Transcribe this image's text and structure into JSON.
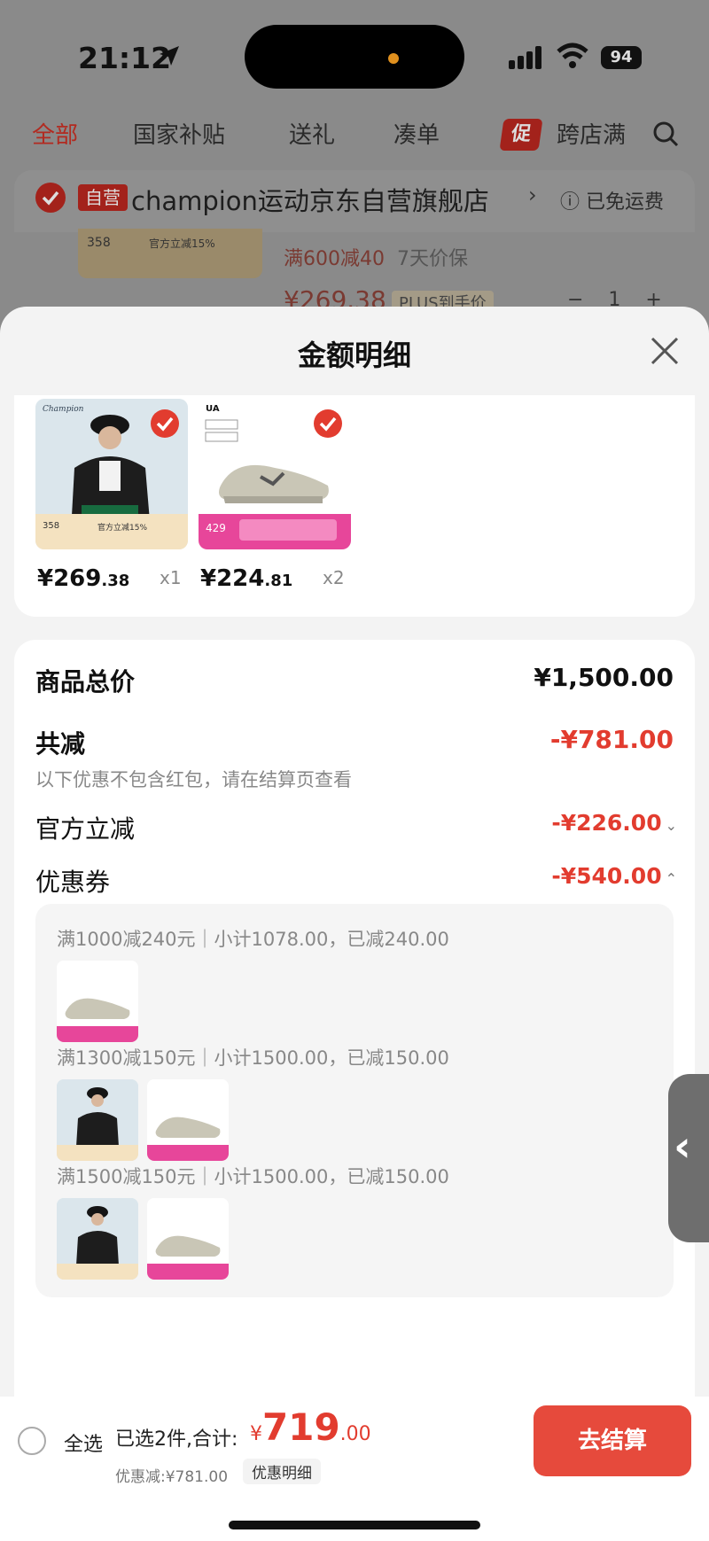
{
  "status": {
    "time": "21:12",
    "battery": "94"
  },
  "tabs": [
    "全部",
    "国家补贴",
    "送礼",
    "凑单",
    "跨店满"
  ],
  "tab_promo_badge": "促",
  "store": {
    "tag": "自营",
    "name": "champion运动京东自营旗舰店",
    "free_shipping": "已免运费",
    "promo": "满600减40",
    "price_protect": "7天价保",
    "price": "¥269.38",
    "plus_label": "PLUS到手价",
    "qty": "1",
    "minus": "−",
    "plus": "+",
    "thumb_price": "358",
    "thumb_tag": "官方立减15%"
  },
  "sheet": {
    "title": "金额明细",
    "products": [
      {
        "price_int": "¥269",
        "price_dec": ".38",
        "qty": "x1",
        "thumb_price": "358",
        "thumb_tag": "官方立减15%",
        "thumb_brand": "Champion"
      },
      {
        "price_int": "¥224",
        "price_dec": ".81",
        "qty": "x2",
        "thumb_price": "429",
        "thumb_brand": "UA"
      }
    ],
    "total_label": "商品总价",
    "total_value": "¥1,500.00",
    "discount_label": "共减",
    "discount_value": "-¥781.00",
    "discount_hint": "以下优惠不包含红包，请在结算页查看",
    "official_label": "官方立减",
    "official_value": "-¥226.00",
    "coupon_label": "优惠券",
    "coupon_value": "-¥540.00",
    "coupon_lines": [
      "满1000减240元｜小计1078.00，已减240.00",
      "满1300减150元｜小计1500.00，已减150.00",
      "满1500减150元｜小计1500.00，已减150.00"
    ]
  },
  "bottom": {
    "select_all": "全选",
    "selected": "已选2件,合计:",
    "currency": "¥",
    "total_int": "719",
    "total_dec": ".00",
    "saved": "优惠减:¥781.00",
    "detail": "优惠明细",
    "checkout": "去结算"
  },
  "colors": {
    "accent": "#e23c2f",
    "checkout": "#e64a3c"
  }
}
